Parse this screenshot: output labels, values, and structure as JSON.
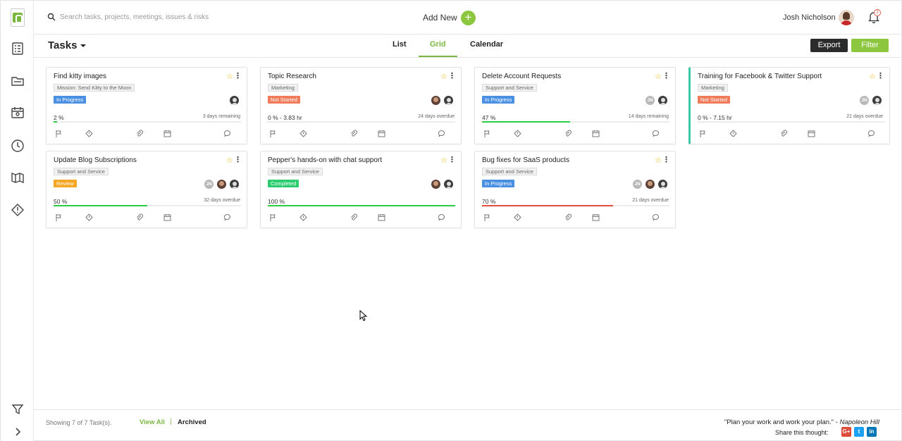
{
  "search": {
    "placeholder": "Search tasks, projects, meetings, issues & risks"
  },
  "header": {
    "add_new_label": "Add New",
    "add_new_symbol": "+",
    "user_name": "Josh Nicholson",
    "notification_count": "2"
  },
  "toolbar": {
    "title": "Tasks",
    "tabs": [
      {
        "label": "List"
      },
      {
        "label": "Grid"
      },
      {
        "label": "Calendar"
      }
    ],
    "active_tab": "Grid",
    "export_label": "Export",
    "filter_label": "Filter"
  },
  "colors": {
    "accent": "#8dc63f",
    "in_progress": "#4a90e2",
    "not_started": "#ef7b5a",
    "review": "#f5a623",
    "completed": "#2ecc71",
    "bar_green": "#2ecc40",
    "bar_red": "#e74c3c",
    "card_highlight": "#3cc8a9"
  },
  "cards": [
    {
      "title": "Find kitty images",
      "project": "Mission: Send Kitty to the Moon",
      "status": "In Progress",
      "progress_text": "2 %",
      "progress": 2,
      "time": "3 days remaining",
      "bar": "green",
      "avatars": [
        "p2"
      ]
    },
    {
      "title": "Topic Research",
      "project": "Marketing",
      "status": "Not Started",
      "progress_text": "0 % - 3.83 hr",
      "progress": 0,
      "time": "24 days overdue",
      "bar": "green",
      "avatars": [
        "p1",
        "p2"
      ]
    },
    {
      "title": "Delete Account Requests",
      "project": "Support and Service",
      "status": "In Progress",
      "progress_text": "47 %",
      "progress": 47,
      "time": "14 days remaining",
      "bar": "green",
      "avatars": [
        "JN",
        "p2"
      ]
    },
    {
      "title": "Training for Facebook & Twitter Support",
      "project": "Marketing",
      "status": "Not Started",
      "progress_text": "0 % - 7.15 hr",
      "progress": 0,
      "time": "21 days overdue",
      "bar": "green",
      "avatars": [
        "JN",
        "p2"
      ],
      "highlight": true
    },
    {
      "title": "Update Blog Subscriptions",
      "project": "Support and Service",
      "status": "Review",
      "progress_text": "50 %",
      "progress": 50,
      "time": "32 days overdue",
      "bar": "green",
      "avatars": [
        "JN",
        "p1",
        "p2"
      ]
    },
    {
      "title": "Pepper's hands-on with chat support",
      "project": "Support and Service",
      "status": "Completed",
      "progress_text": "100 %",
      "progress": 100,
      "time": "",
      "bar": "green",
      "avatars": [
        "p1",
        "p2"
      ]
    },
    {
      "title": "Bug fixes for SaaS products",
      "project": "Support and Service",
      "status": "In Progress",
      "progress_text": "70 %",
      "progress": 70,
      "time": "21 days overdue",
      "bar": "red",
      "avatars": [
        "JN",
        "p1",
        "p2"
      ]
    }
  ],
  "footer": {
    "count_text": "Showing 7 of 7 Task(s).",
    "view_all": "View All",
    "separator": "|",
    "archived": "Archived",
    "quote_text": "\"Plan your work and work your plan.\" - ",
    "quote_author": "Napoleon Hill",
    "share_label": "Share this thought:",
    "share_buttons": [
      "G+",
      "t",
      "in"
    ]
  }
}
